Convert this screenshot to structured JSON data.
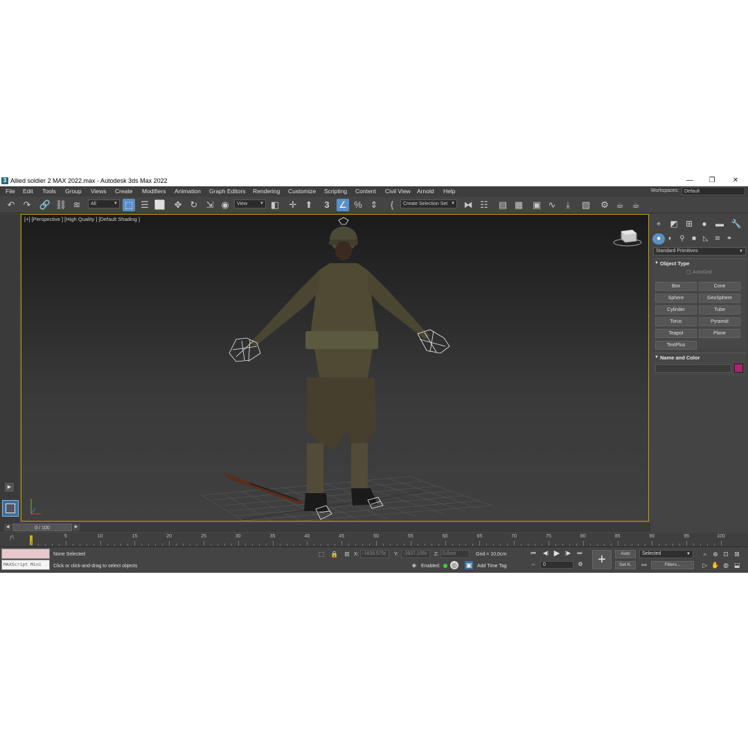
{
  "window": {
    "title": "Allied soldier 2 MAX 2022.max - Autodesk 3ds Max 2022",
    "app_icon_glyph": "3",
    "minimize_glyph": "—",
    "restore_glyph": "❐",
    "close_glyph": "✕"
  },
  "menu": {
    "items": [
      "File",
      "Edit",
      "Tools",
      "Group",
      "Views",
      "Create",
      "Modifiers",
      "Animation",
      "Graph Editors",
      "Rendering",
      "Customize",
      "Scripting",
      "Content",
      "Civil View",
      "Arnold",
      "Help"
    ],
    "workspaces_label": "Workspaces:",
    "workspaces_value": "Default"
  },
  "toolbar": {
    "selection_filter": "All",
    "ref_coord": "View",
    "named_selection": "Create Selection Set",
    "snap_label": "3"
  },
  "viewport": {
    "label": "[+] [Perspective ] [High Quality ] [Default Shading ]"
  },
  "command_panel": {
    "category": "Standard Primitives",
    "object_type_title": "Object Type",
    "autogrid_label": "AutoGrid",
    "primitives": [
      "Box",
      "Cone",
      "Sphere",
      "GeoSphere",
      "Cylinder",
      "Tube",
      "Torus",
      "Pyramid",
      "Teapot",
      "Plane",
      "TextPlus"
    ],
    "name_color_title": "Name and Color",
    "object_color": "#b0226f"
  },
  "time_slider": {
    "frame_display": "0 / 100",
    "prev_glyph": "◀",
    "next_glyph": "▶"
  },
  "track_bar": {
    "ticks": [
      "5",
      "10",
      "15",
      "20",
      "25",
      "30",
      "35",
      "40",
      "45",
      "50",
      "55",
      "60",
      "65",
      "70",
      "75",
      "80",
      "85",
      "90",
      "95",
      "100"
    ]
  },
  "status": {
    "maxscript_label": "MAXScript Mini",
    "selection_status": "None Selected",
    "prompt": "Click or click-and-drag to select objects",
    "x_label": "X:",
    "x_value": "-1839,575c",
    "y_label": "Y:",
    "y_value": "-2837,155c",
    "z_label": "Z:",
    "z_value": "0,0cm",
    "grid": "Grid = 10,0cm",
    "enabled_label": "Enabled:",
    "add_time_tag": "Add Time Tag",
    "auto_key": "Auto",
    "set_key": "Set K.",
    "key_filter_value": "Selected",
    "filters": "Filters...",
    "current_frame": "0"
  }
}
